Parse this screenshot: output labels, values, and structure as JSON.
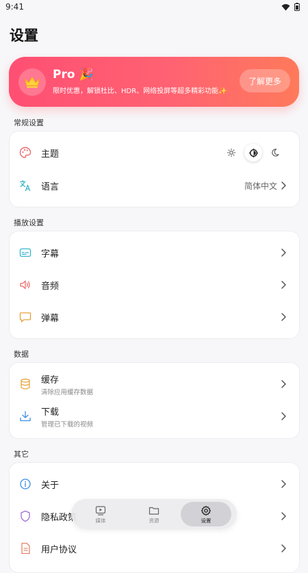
{
  "status_bar": {
    "time": "9:41"
  },
  "page_title": "设置",
  "pro": {
    "title": "Pro 🎉",
    "description": "限时优惠，解锁杜比、HDR、网络投屏等超多精彩功能✨",
    "more_button": "了解更多",
    "colors": {
      "start": "#ff4f73",
      "end": "#ff7a5b"
    }
  },
  "sections": {
    "general": {
      "label": "常规设置",
      "theme_label": "主题",
      "theme_options": [
        "light-icon",
        "auto-icon",
        "dark-icon"
      ],
      "theme_selected": "auto",
      "language_label": "语言",
      "language_value": "简体中文"
    },
    "playback": {
      "label": "播放设置",
      "subtitle_label": "字幕",
      "audio_label": "音频",
      "danmaku_label": "弹幕"
    },
    "data": {
      "label": "数据",
      "cache_label": "缓存",
      "cache_sub": "清除应用缓存数据",
      "download_label": "下载",
      "download_sub": "管理已下载的视频"
    },
    "other": {
      "label": "其它",
      "about_label": "关于",
      "privacy_label": "隐私政策",
      "agreement_label": "用户协议"
    }
  },
  "bottom_nav": {
    "items": [
      {
        "label": "媒体",
        "icon": "media-icon"
      },
      {
        "label": "资源",
        "icon": "folder-icon"
      },
      {
        "label": "设置",
        "icon": "gear-icon"
      }
    ],
    "active": "设置"
  },
  "icon_colors": {
    "palette": "#ec6b6b",
    "language": "#3bb8c7",
    "subtitle": "#38b7c9",
    "audio": "#ec6b6b",
    "danmaku": "#e6a23c",
    "cache": "#e6a23c",
    "download": "#3a8ee6",
    "about": "#3a8ee6",
    "privacy": "#9b6bd6",
    "agreement": "#e8826a"
  }
}
